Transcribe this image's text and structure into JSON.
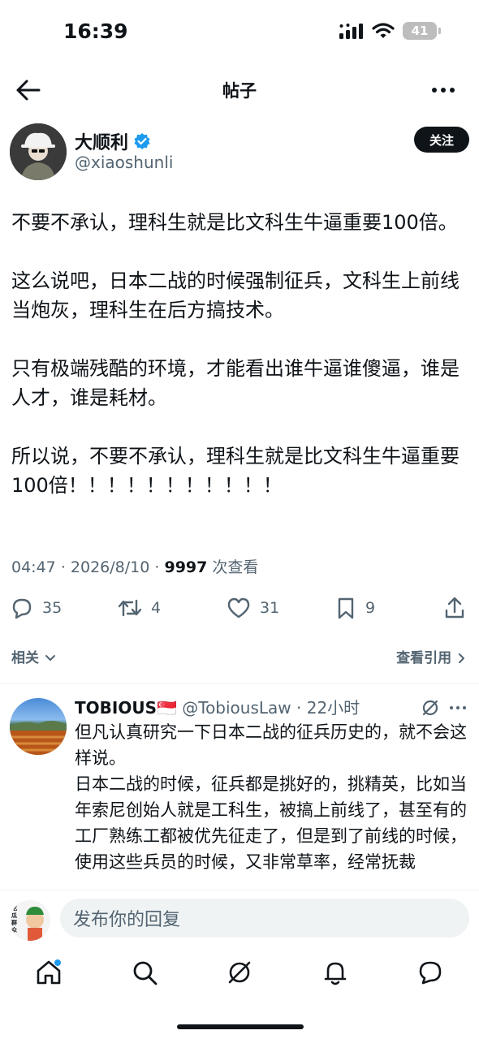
{
  "status_bar": {
    "time": "16:39",
    "battery": "41"
  },
  "nav": {
    "title": "帖子"
  },
  "author": {
    "name": "大顺利",
    "handle": "@xiaoshunli",
    "follow_label": "关注"
  },
  "post": {
    "paragraphs": [
      "不要不承认，理科生就是比文科生牛逼重要100倍。",
      "这么说吧，日本二战的时候强制征兵，文科生上前线当炮灰，理科生在后方搞技术。",
      "只有极端残酷的环境，才能看出谁牛逼谁傻逼，谁是人才，谁是耗材。",
      "所以说，不要不承认，理科生就是比文科生牛逼重要100倍！！！！！！！！！！！"
    ],
    "time": "04:47",
    "date": "2026/8/10",
    "views": "9997",
    "views_label": "次查看"
  },
  "actions": {
    "replies": "35",
    "reposts": "4",
    "likes": "31",
    "bookmarks": "9"
  },
  "related": {
    "left_label": "相关",
    "right_label": "查看引用"
  },
  "reply": {
    "name": "TOBIOUS🇸🇬",
    "handle": "@TobiousLaw",
    "time": "22小时",
    "line1": "但凡认真研究一下日本二战的征兵历史的，就不会这样说。",
    "line2": "日本二战的时候，征兵都是挑好的，挑精英，比如当年索尼创始人就是工科生，被搞上前线了，甚至有的工厂熟练工都被优先征走了，但是到了前线的时候， 使用这些兵员的时候，又非常草率，经常抚裁"
  },
  "composer": {
    "placeholder": "发布你的回复",
    "avatar_text": "吃瓜群众"
  },
  "colors": {
    "text": "#0f1419",
    "secondary": "#536471",
    "verified": "#1d9bf0",
    "notify_dot": "#1d9bf0"
  }
}
